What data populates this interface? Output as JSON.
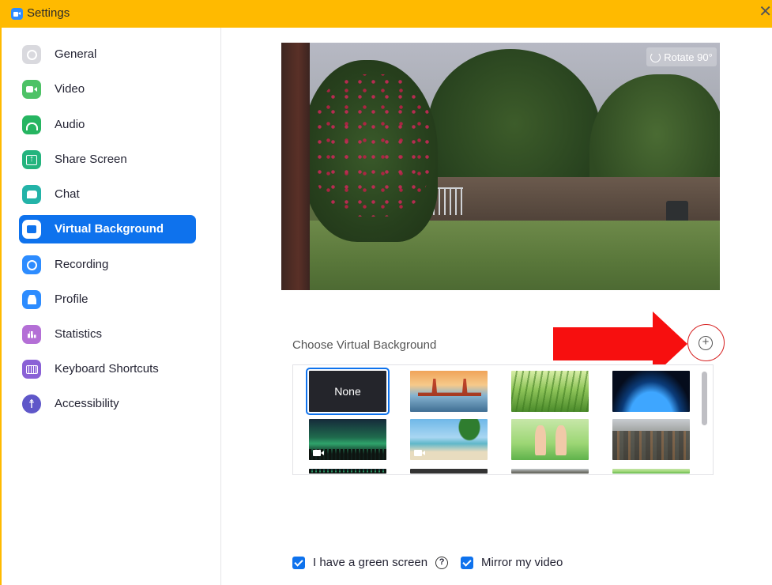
{
  "window": {
    "title": "Settings",
    "close_glyph": "✕"
  },
  "sidebar": {
    "items": [
      {
        "label": "General",
        "icon": "gear-icon",
        "active": false
      },
      {
        "label": "Video",
        "icon": "video-camera-icon",
        "active": false
      },
      {
        "label": "Audio",
        "icon": "headphones-icon",
        "active": false
      },
      {
        "label": "Share Screen",
        "icon": "share-screen-icon",
        "active": false
      },
      {
        "label": "Chat",
        "icon": "chat-bubble-icon",
        "active": false
      },
      {
        "label": "Virtual Background",
        "icon": "virtual-background-icon",
        "active": true
      },
      {
        "label": "Recording",
        "icon": "record-icon",
        "active": false
      },
      {
        "label": "Profile",
        "icon": "person-icon",
        "active": false
      },
      {
        "label": "Statistics",
        "icon": "bar-chart-icon",
        "active": false
      },
      {
        "label": "Keyboard Shortcuts",
        "icon": "keyboard-icon",
        "active": false
      },
      {
        "label": "Accessibility",
        "icon": "accessibility-icon",
        "active": false
      }
    ]
  },
  "preview": {
    "rotate_label": "Rotate 90°"
  },
  "virtual_background": {
    "section_label": "Choose Virtual Background",
    "add_glyph": "+",
    "tiles": [
      {
        "label": "None",
        "selected": true
      },
      {
        "label": "",
        "theme": "golden-gate-bridge"
      },
      {
        "label": "",
        "theme": "grass"
      },
      {
        "label": "",
        "theme": "earth-from-space"
      },
      {
        "label": "",
        "theme": "aurora",
        "is_video": true
      },
      {
        "label": "",
        "theme": "tropical-beach",
        "is_video": true
      },
      {
        "label": "",
        "theme": "cartoon-characters"
      },
      {
        "label": "",
        "theme": "battle-scene"
      }
    ]
  },
  "options": {
    "green_screen_label": "I have a green screen",
    "green_screen_checked": true,
    "help_glyph": "?",
    "mirror_label": "Mirror my video",
    "mirror_checked": true
  },
  "colors": {
    "titlebar": "#ffba00",
    "accent": "#0e72ed",
    "annotation_red": "#f70f0f"
  }
}
